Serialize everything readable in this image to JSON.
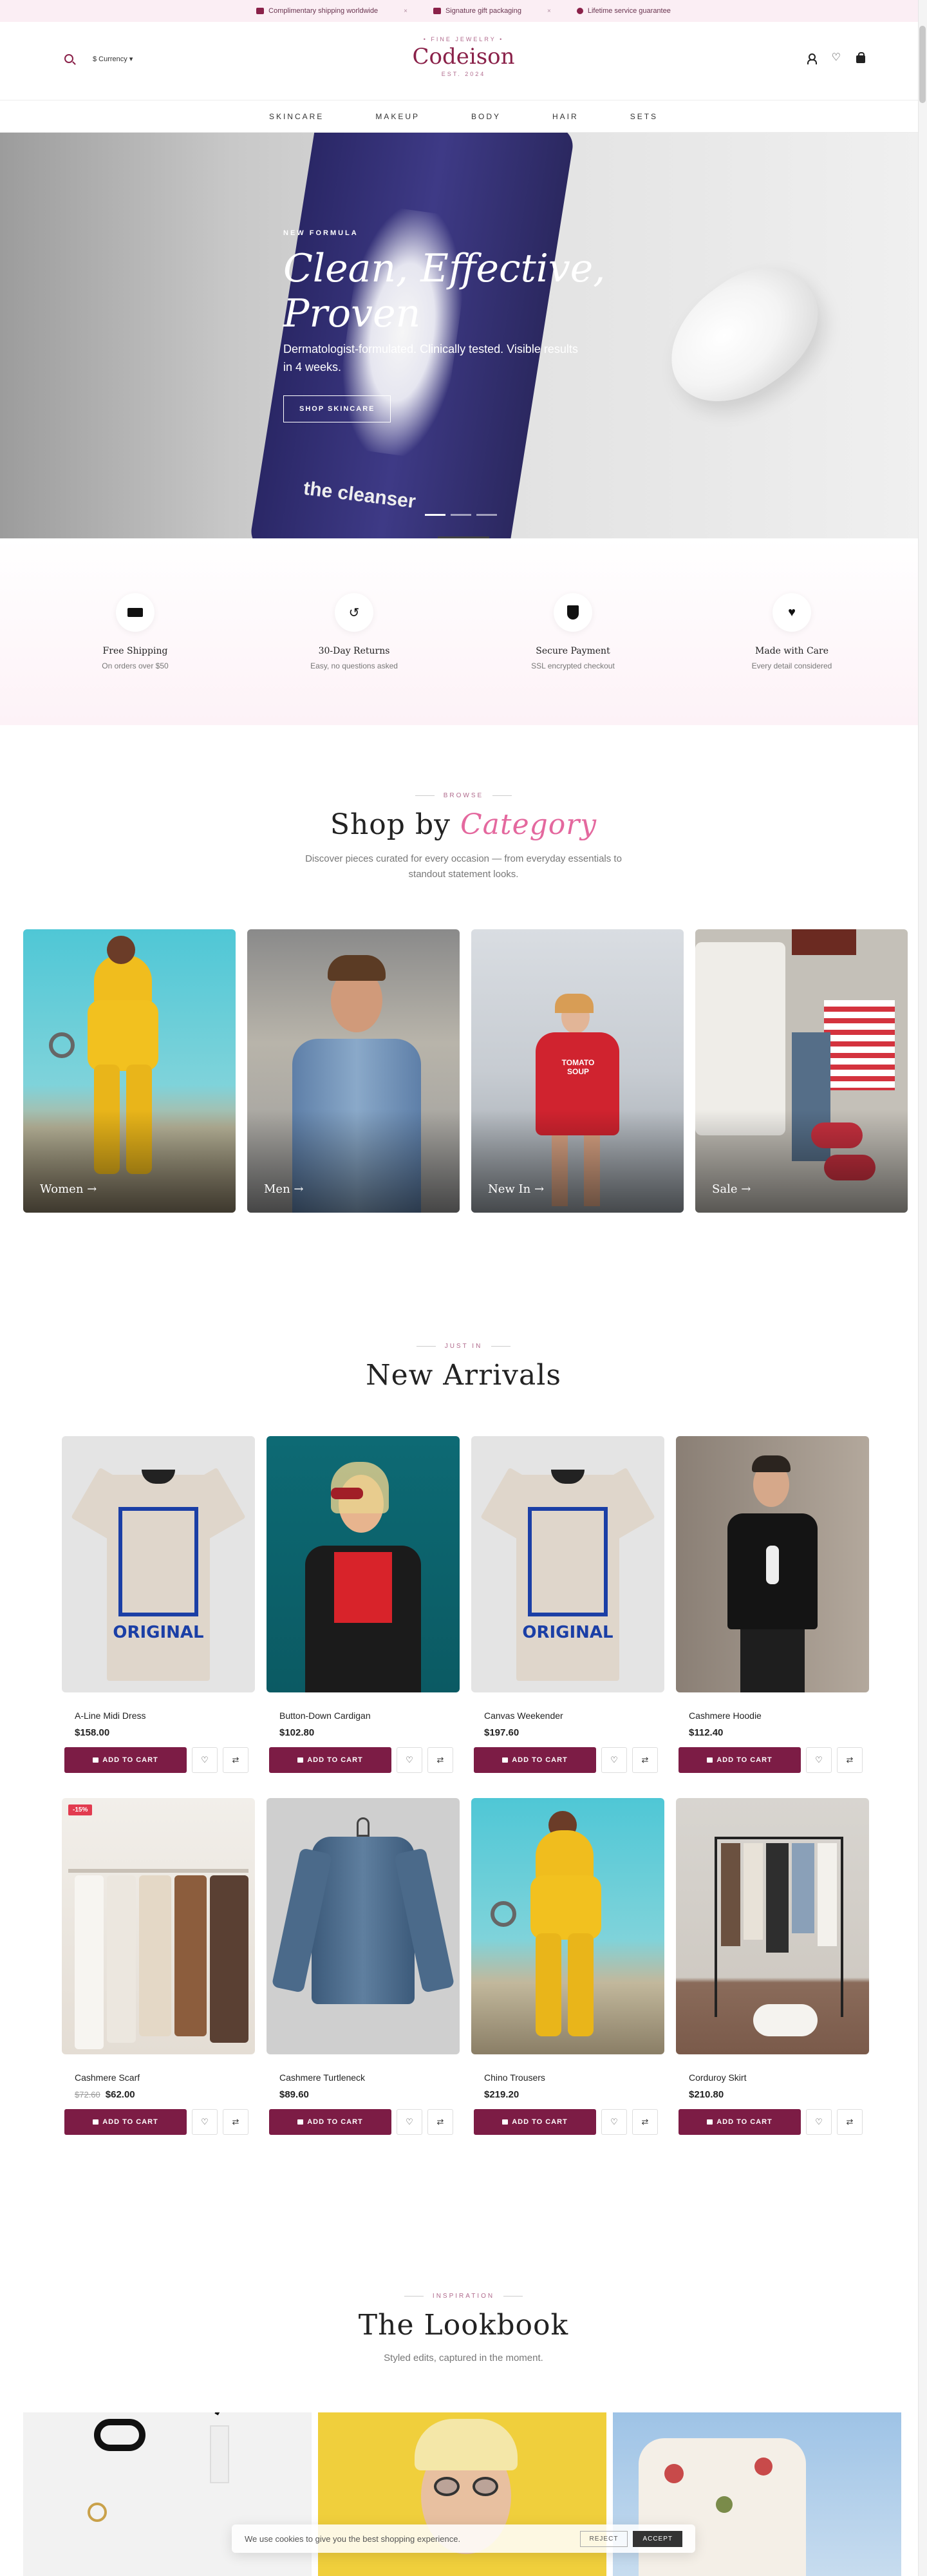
{
  "announce": {
    "items": [
      "Complimentary shipping worldwide",
      "Signature gift packaging",
      "Lifetime service guarantee"
    ],
    "sep": "×"
  },
  "header": {
    "tagline": "• FINE JEWELRY •",
    "brand": "Codeison",
    "est": "EST. 2024",
    "currency": "$ Currency ▾"
  },
  "nav": [
    "SKINCARE",
    "MAKEUP",
    "BODY",
    "HAIR",
    "SETS"
  ],
  "hero": {
    "kicker": "NEW FORMULA",
    "title": "Clean, Effective, Proven",
    "subtitle": "Dermatologist-formulated. Clinically tested. Visible results in 4 weeks.",
    "cta": "SHOP SKINCARE",
    "tube_text": "the cleanser",
    "slides": 3,
    "active_slide": 1
  },
  "features": [
    {
      "title": "Free Shipping",
      "sub": "On orders over $50",
      "icon": "truck-icon"
    },
    {
      "title": "30-Day Returns",
      "sub": "Easy, no questions asked",
      "icon": "return-icon"
    },
    {
      "title": "Secure Payment",
      "sub": "SSL encrypted checkout",
      "icon": "shield-icon"
    },
    {
      "title": "Made with Care",
      "sub": "Every detail considered",
      "icon": "heart-icon"
    }
  ],
  "category": {
    "eyebrow": "BROWSE",
    "title_a": "Shop by",
    "title_b": "Category",
    "sub": "Discover pieces curated for every occasion — from everyday essentials to standout statement looks.",
    "items": [
      "Women →",
      "Men →",
      "New In →",
      "Sale →"
    ]
  },
  "arrivals": {
    "eyebrow": "JUST IN",
    "title": "New Arrivals",
    "cta": "ADD TO CART",
    "products": [
      {
        "name": "A-Line Midi Dress",
        "price": "$158.00"
      },
      {
        "name": "Button-Down Cardigan",
        "price": "$102.80"
      },
      {
        "name": "Canvas Weekender",
        "price": "$197.60"
      },
      {
        "name": "Cashmere Hoodie",
        "price": "$112.40"
      },
      {
        "name": "Cashmere Scarf",
        "old": "$72.60",
        "price": "$62.00",
        "badge": "-15%"
      },
      {
        "name": "Cashmere Turtleneck",
        "price": "$89.60"
      },
      {
        "name": "Chino Trousers",
        "price": "$219.20"
      },
      {
        "name": "Corduroy Skirt",
        "price": "$210.80"
      }
    ]
  },
  "tee_text": "ORIGINAL",
  "lookbook": {
    "eyebrow": "INSPIRATION",
    "title": "The Lookbook",
    "sub": "Styled edits, captured in the moment."
  },
  "cookie": {
    "text": "We use cookies to give you the best shopping experience.",
    "reject": "REJECT",
    "accept": "ACCEPT"
  }
}
